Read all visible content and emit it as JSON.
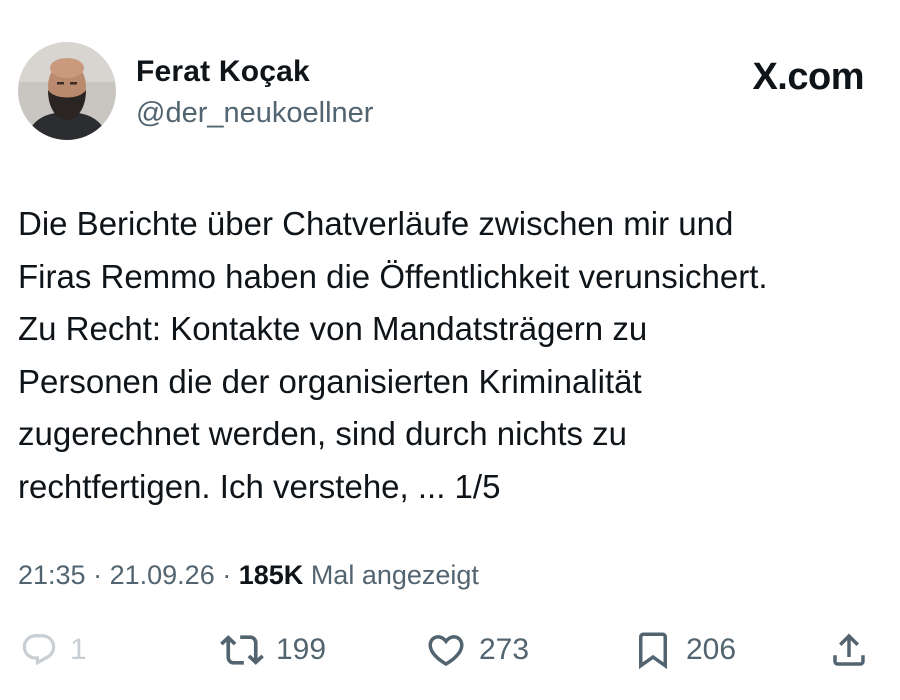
{
  "author": {
    "display_name": "Ferat Koçak",
    "handle": "@der_neukoellner",
    "avatar_icon": "profile-photo"
  },
  "brand": {
    "label": "X.com"
  },
  "post": {
    "text": "Die Berichte über Chatverläufe zwischen mir und\nFiras Remmo haben die Öffentlichkeit verunsichert.\nZu Recht: Kontakte von Mandatsträgern zu\nPersonen die der organisierten Kriminalität\nzugerechnet werden, sind durch nichts zu\nrechtfertigen. Ich verstehe, ... 1/5"
  },
  "meta": {
    "time": "21:35",
    "separator": "·",
    "date": "21.09.26",
    "views_count": "185K",
    "views_label": "Mal angezeigt"
  },
  "actions": {
    "reply": {
      "icon": "reply-icon",
      "count": "1"
    },
    "retweet": {
      "icon": "retweet-icon",
      "count": "199"
    },
    "like": {
      "icon": "heart-icon",
      "count": "273"
    },
    "bookmark": {
      "icon": "bookmark-icon",
      "count": "206"
    },
    "share": {
      "icon": "share-icon"
    }
  },
  "colors": {
    "text_primary": "#0f1419",
    "text_secondary": "#536471",
    "reply_muted": "#c8ced3"
  }
}
